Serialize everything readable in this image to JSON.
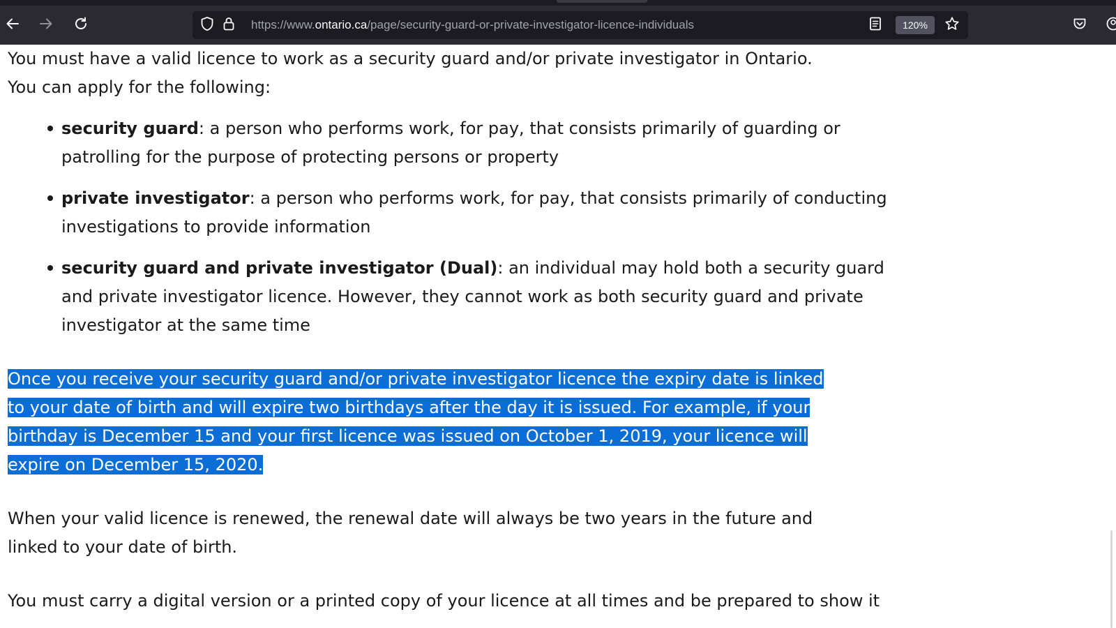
{
  "browser": {
    "url_prefix": "https://www.",
    "url_host": "ontario.ca",
    "url_path": "/page/security-guard-or-private-investigator-licence-individuals",
    "zoom": "120%",
    "icons": {
      "back": "arrow-left-icon",
      "forward": "arrow-right-icon",
      "reload": "reload-icon",
      "shield": "shield-icon",
      "lock": "lock-icon",
      "reader": "reader-view-icon",
      "bookmark": "star-icon",
      "pocket": "pocket-icon",
      "account": "account-icon"
    }
  },
  "article": {
    "intro": "You must have a valid licence to work as a security guard and/or private investigator in Ontario. You can apply for the following:",
    "licence_types": [
      {
        "term": "security guard",
        "definition": ": a person who performs work, for pay, that consists primarily of guarding or patrolling for the purpose of protecting persons or property"
      },
      {
        "term": "private investigator",
        "definition": ": a person who performs work, for pay, that consists primarily of conducting investigations to provide information"
      },
      {
        "term": "security guard and private investigator (Dual)",
        "definition": ": an individual may hold both a security guard and private investigator licence. However, they cannot work as both security guard and private investigator at the same time"
      }
    ],
    "expiry_text": "Once you receive your security guard and/or private investigator licence the expiry date is linked to your date of birth and will expire two birthdays after the day it is issued. For example, if your birthday is December 15 and your first licence was issued on October 1, 2019, your licence will expire on December 15, 2020.",
    "renewal_text": "When your valid licence is renewed, the renewal date will always be two years in the future and linked to your date of birth.",
    "carry_text": "You must carry a digital version or a printed copy of your licence at all times and be prepared to show it"
  },
  "colors": {
    "toolbar": "#2b2a33",
    "urlbar": "#1c1b22",
    "selection": "#0a6ed6"
  }
}
